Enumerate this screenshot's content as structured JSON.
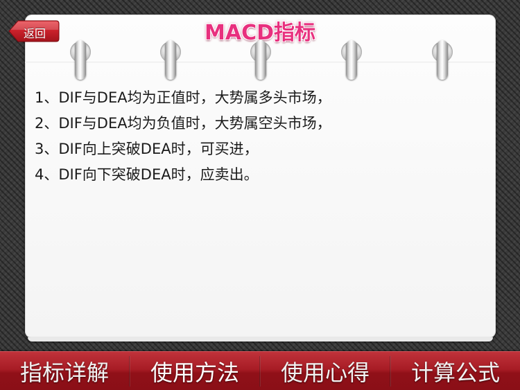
{
  "header": {
    "back_label": "返回",
    "title": "MACD指标"
  },
  "content": {
    "lines": [
      "1、DIF与DEA均为正值时，大势属多头市场，",
      "2、DIF与DEA均为负值时，大势属空头市场，",
      "3、DIF向上突破DEA时，可买进，",
      "4、DIF向下突破DEA时，应卖出。"
    ]
  },
  "tabs": [
    {
      "label": "指标详解",
      "active": false
    },
    {
      "label": "使用方法",
      "active": true
    },
    {
      "label": "使用心得",
      "active": false
    },
    {
      "label": "计算公式",
      "active": false
    }
  ],
  "colors": {
    "title": "#e8307e",
    "tabbar": "#a71c25",
    "back_button": "#c8202a"
  },
  "icons": {
    "back": "back-arrow-icon",
    "rings": "binder-ring-icon"
  }
}
